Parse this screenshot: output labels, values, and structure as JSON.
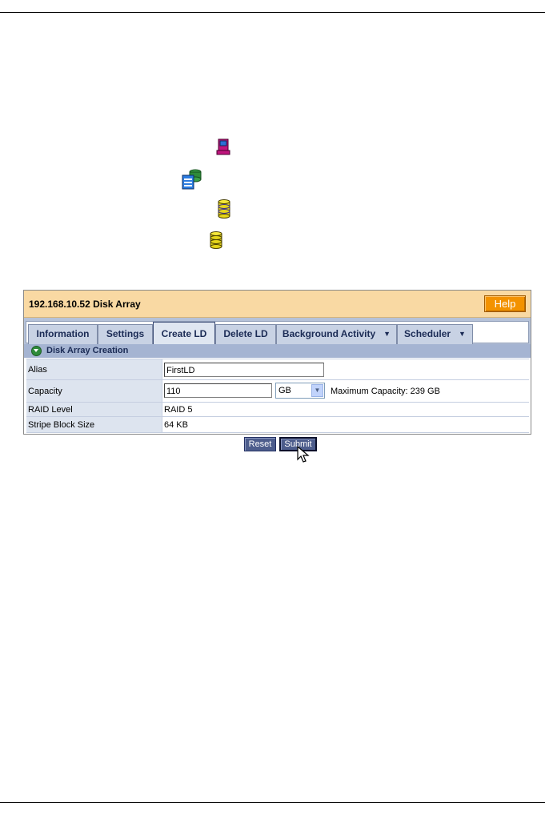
{
  "tree_icons": [
    {
      "name": "subsystem-icon"
    },
    {
      "name": "disk-arrays-icon"
    },
    {
      "name": "disk-array-icon"
    },
    {
      "name": "logical-drive-icon"
    }
  ],
  "panel": {
    "title": "192.168.10.52 Disk Array",
    "help_label": "Help",
    "tabs": [
      {
        "label": "Information"
      },
      {
        "label": "Settings"
      },
      {
        "label": "Create LD",
        "active": true
      },
      {
        "label": "Delete LD"
      },
      {
        "label": "Background Activity",
        "dropdown": true
      },
      {
        "label": "Scheduler",
        "dropdown": true
      }
    ],
    "section_title": "Disk Array Creation",
    "fields": {
      "alias": {
        "label": "Alias",
        "value": "FirstLD"
      },
      "capacity": {
        "label": "Capacity",
        "value": "110",
        "unit": "GB",
        "max_text": "Maximum Capacity: 239 GB"
      },
      "raid_level": {
        "label": "RAID Level",
        "value": "RAID 5"
      },
      "stripe_block_size": {
        "label": "Stripe Block Size",
        "value": "64 KB"
      }
    }
  },
  "buttons": {
    "reset_label": "Reset",
    "submit_label": "Submit"
  }
}
